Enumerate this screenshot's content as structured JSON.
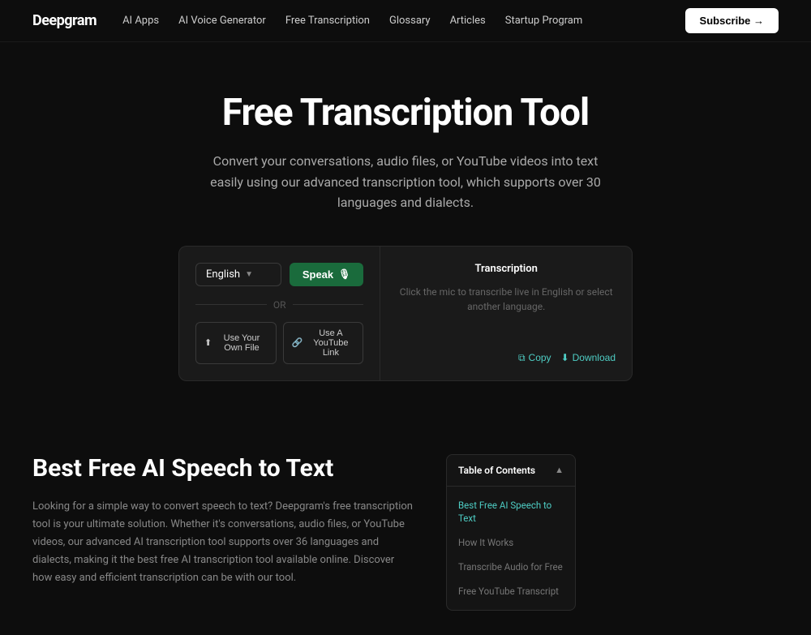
{
  "brand": {
    "logo": "Deepgram"
  },
  "navbar": {
    "links": [
      {
        "label": "AI Apps",
        "id": "ai-apps"
      },
      {
        "label": "AI Voice Generator",
        "id": "ai-voice"
      },
      {
        "label": "Free Transcription",
        "id": "free-transcription"
      },
      {
        "label": "Glossary",
        "id": "glossary"
      },
      {
        "label": "Articles",
        "id": "articles"
      },
      {
        "label": "Startup Program",
        "id": "startup"
      }
    ],
    "cta": "Subscribe →"
  },
  "hero": {
    "title": "Free Transcription Tool",
    "subtitle": "Convert your conversations, audio files, or YouTube videos into text easily using our advanced transcription tool, which supports over 30 languages and dialects."
  },
  "tool": {
    "language_select": "English",
    "speak_button": "Speak",
    "or_label": "OR",
    "file_button": "Use Your Own File",
    "youtube_button": "Use A YouTube Link",
    "transcription_title": "Transcription",
    "transcription_hint": "Click the mic to transcribe live in English or select another language.",
    "copy_button": "Copy",
    "download_button": "Download"
  },
  "content": {
    "title": "Best Free AI Speech to Text",
    "text": "Looking for a simple way to convert speech to text? Deepgram's free transcription tool is your ultimate solution. Whether it's conversations, audio files, or YouTube videos, our advanced AI transcription tool supports over 36 languages and dialects, making it the best free AI transcription tool available online. Discover how easy and efficient transcription can be with our tool."
  },
  "toc": {
    "title": "Table of Contents",
    "items": [
      {
        "label": "Best Free AI Speech to Text",
        "active": true
      },
      {
        "label": "How It Works",
        "active": false
      },
      {
        "label": "Transcribe Audio for Free",
        "active": false
      },
      {
        "label": "Free YouTube Transcript",
        "active": false
      }
    ]
  }
}
